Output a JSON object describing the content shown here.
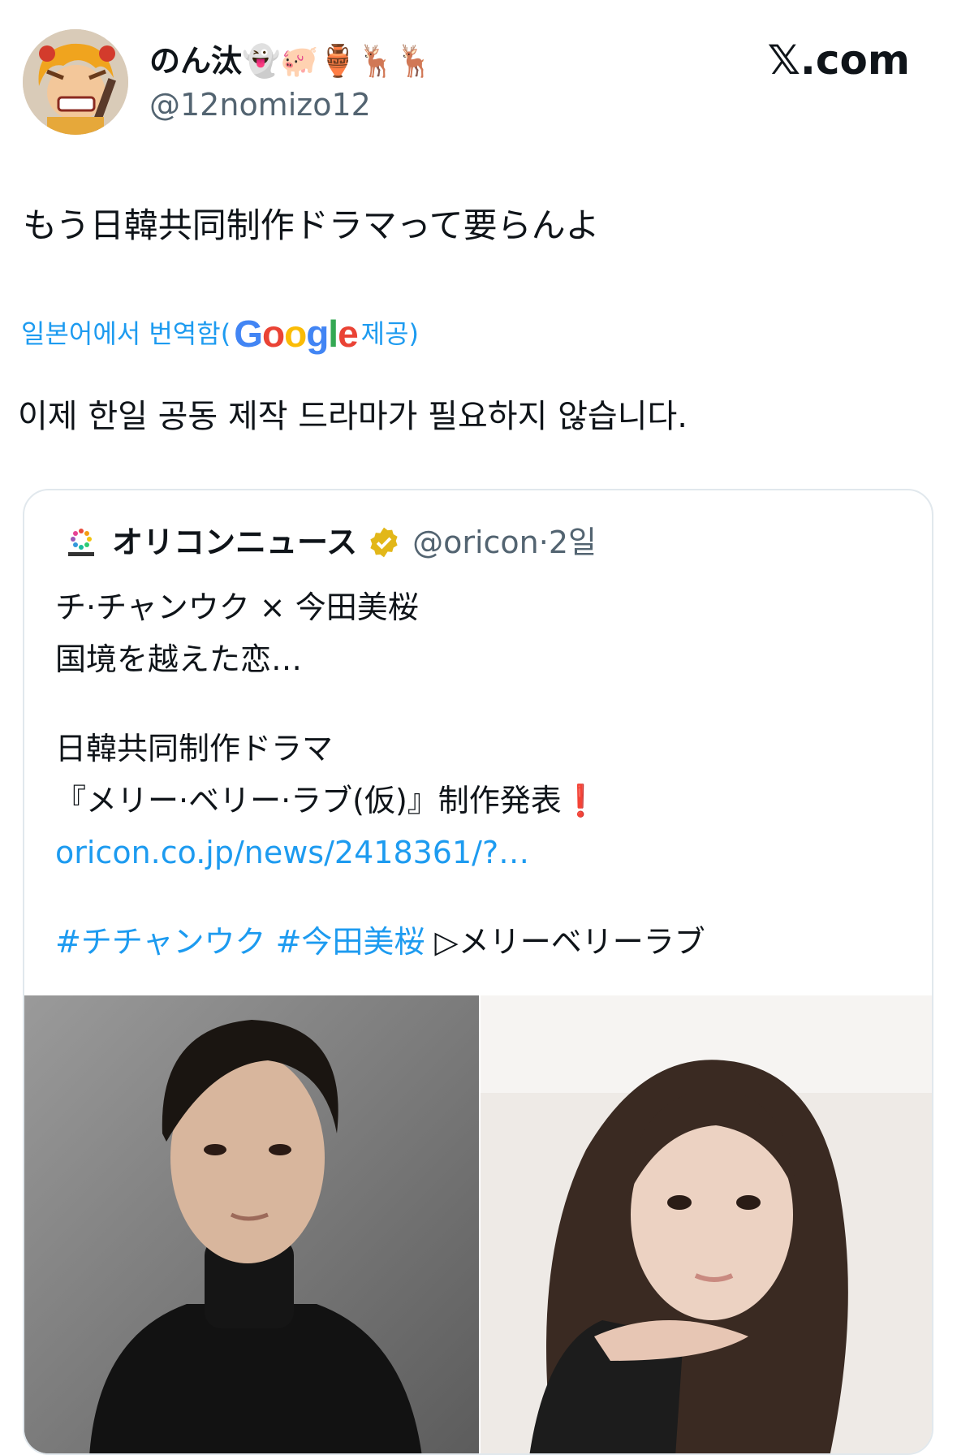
{
  "user": {
    "display_name": "のん汰👻🐖🏺🦌🦌",
    "handle": "@12nomizo12",
    "avatar": "anime-character-avatar"
  },
  "source_label": "𝕏.com",
  "tweet": {
    "text": "もう日韓共同制作ドラマって要らんよ",
    "translate_prefix": "일본어에서 번역함(",
    "translate_brand": "Google",
    "translate_suffix": " 제공)",
    "translated_text": "이제 한일 공동 제작 드라마가 필요하지 않습니다."
  },
  "quote": {
    "name": "オリコンニュース",
    "handle": "@oricon",
    "separator": " · ",
    "time": "2일",
    "lines": [
      "チ·チャンウク × 今田美桜",
      "国境を越えた恋…",
      "",
      "日韓共同制作ドラマ",
      "『メリー·ベリー·ラブ(仮)』制作発表❗"
    ],
    "link": "oricon.co.jp/news/2418361/?…",
    "hashtag1": "#チチャンウク",
    "hashtag2": "#今田美桜",
    "tail": " ▷メリーベリーラブ",
    "colors": {
      "link": "#1d9bf0",
      "badge": "#e2b719"
    }
  }
}
